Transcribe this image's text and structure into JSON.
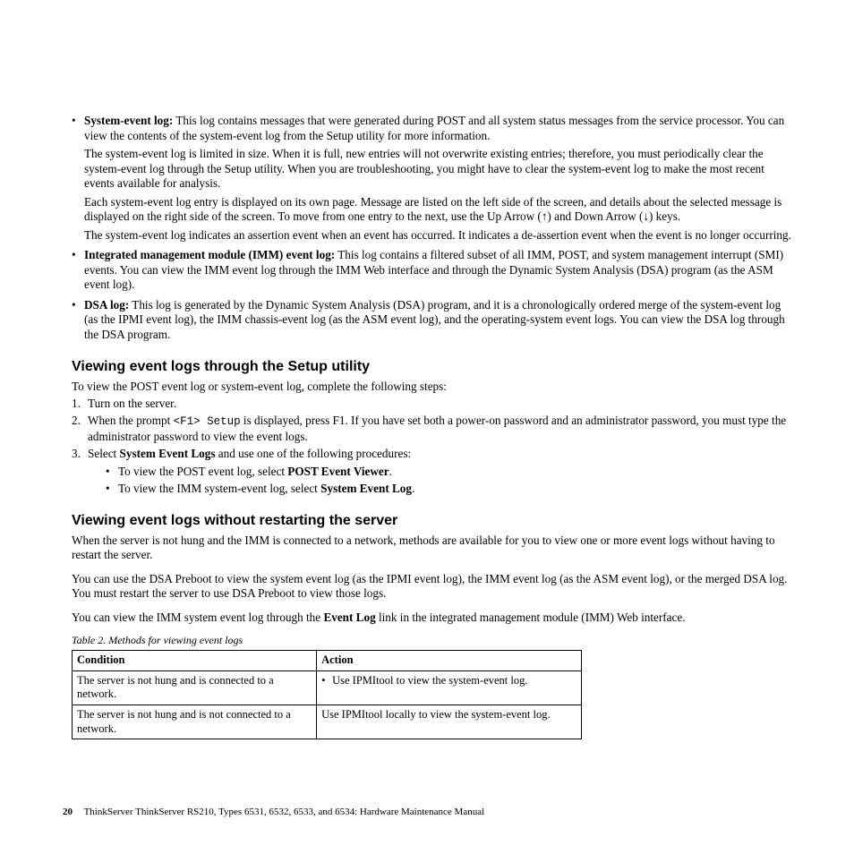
{
  "logs": {
    "items": [
      {
        "title": "System-event log:",
        "p1": "This log contains messages that were generated during POST and all system status messages from the service processor. You can view the contents of the system-event log from the Setup utility for more information.",
        "p2": "The system-event log is limited in size. When it is full, new entries will not overwrite existing entries; therefore, you must periodically clear the system-event log through the Setup utility. When you are troubleshooting, you might have to clear the system-event log to make the most recent events available for analysis.",
        "p3a": "Each system-event log entry is displayed on its own page. Message are listed on the left side of the screen, and details about the selected message is displayed on the right side of the screen. To move from one entry to the next, use the Up Arrow (",
        "up": "↑",
        "p3b": ") and Down Arrow (",
        "down": "↓",
        "p3c": ") keys.",
        "p4": "The system-event log indicates an assertion event when an event has occurred. It indicates a de-assertion event when the event is no longer occurring."
      },
      {
        "title": "Integrated management module (IMM) event log:",
        "p1": "This log contains a filtered subset of all IMM, POST, and system management interrupt (SMI) events. You can view the IMM event log through the IMM Web interface and through the Dynamic System Analysis (DSA) program (as the ASM event log)."
      },
      {
        "title": "DSA log:",
        "p1": "This log is generated by the Dynamic System Analysis (DSA) program, and it is a chronologically ordered merge of the system-event log (as the IPMI event log), the IMM chassis-event log (as the ASM event log), and the operating-system event logs. You can view the DSA log through the DSA program."
      }
    ]
  },
  "section1": {
    "heading": "Viewing event logs through the Setup utility",
    "intro": "To view the POST event log or system-event log, complete the following steps:",
    "steps": [
      {
        "text": "Turn on the server."
      },
      {
        "pre": "When the prompt ",
        "code": "<F1> Setup",
        "post": " is displayed, press F1. If you have set both a power-on password and an administrator password, you must type the administrator password to view the event logs."
      },
      {
        "pre": "Select ",
        "bold": "System Event Logs",
        "post": " and use one of the following procedures:",
        "subs": [
          {
            "pre": "To view the POST event log, select ",
            "bold": "POST Event Viewer",
            "post": "."
          },
          {
            "pre": "To view the IMM system-event log, select ",
            "bold": "System Event Log",
            "post": "."
          }
        ]
      }
    ]
  },
  "section2": {
    "heading": "Viewing event logs without restarting the server",
    "p1": "When the server is not hung and the IMM is connected to a network, methods are available for you to view one or more event logs without having to restart the server.",
    "p2": "You can use the DSA Preboot to view the system event log (as the IPMI event log), the IMM event log (as the ASM event log), or the merged DSA log. You must restart the server to use DSA Preboot to view those logs.",
    "p3a": "You can view the IMM system event log through the ",
    "p3bold": "Event Log",
    "p3b": " link in the integrated management module (IMM) Web interface."
  },
  "table": {
    "caption": "Table 2. Methods for viewing event logs",
    "h1": "Condition",
    "h2": "Action",
    "rows": [
      {
        "c": "The server is not hung and is connected to a network.",
        "a": "Use IPMItool to view the system-event log.",
        "bulleted": true
      },
      {
        "c": "The server is not hung and is not connected to a network.",
        "a": "Use IPMItool locally to view the system-event log.",
        "bulleted": false
      }
    ]
  },
  "footer": {
    "page": "20",
    "text": "ThinkServer ThinkServer RS210, Types 6531, 6532, 6533, and 6534: Hardware Maintenance Manual"
  }
}
